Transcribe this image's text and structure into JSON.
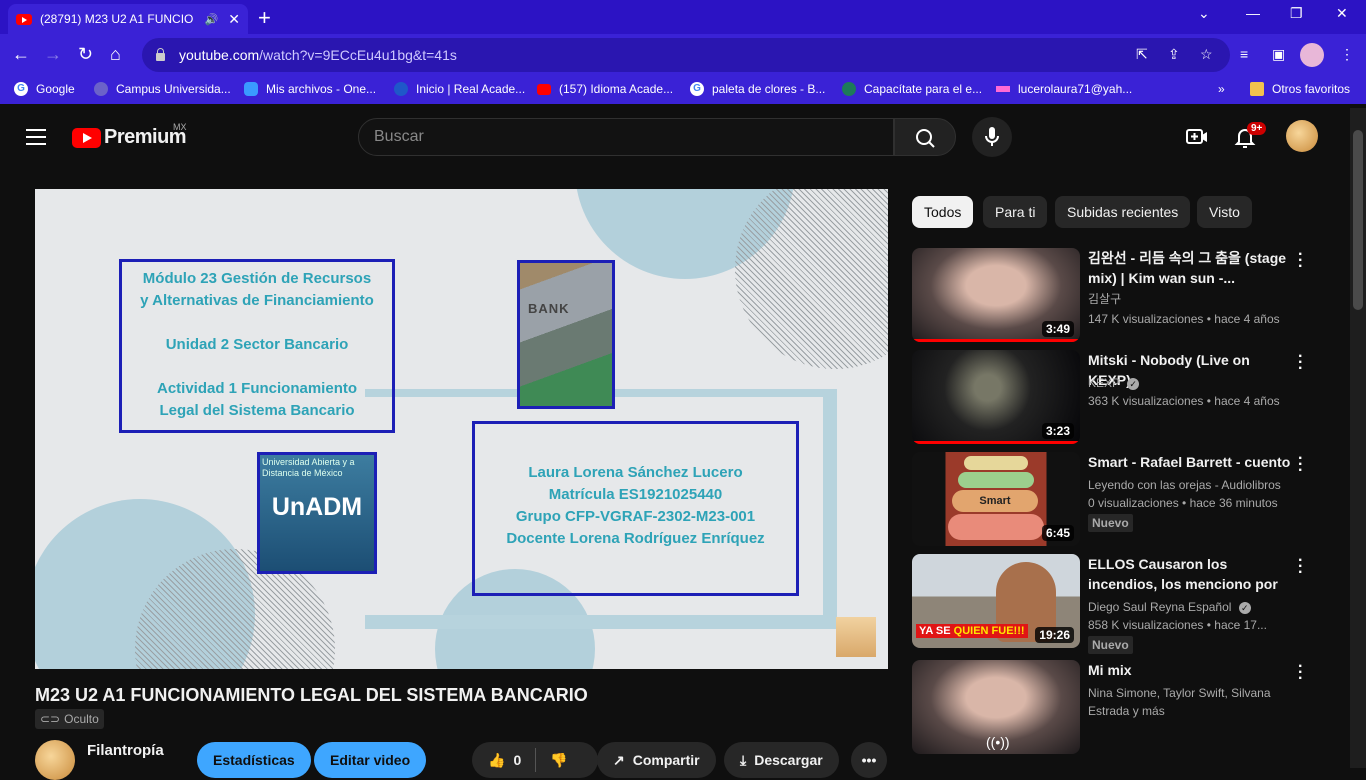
{
  "browser": {
    "tab_title": "(28791) M23 U2 A1 FUNCIO",
    "url_host": "youtube.com",
    "url_path": "/watch?v=9ECcEu4u1bg&t=41s",
    "bookmarks": [
      {
        "label": "Google",
        "icon": "google-icon"
      },
      {
        "label": "Campus Universida...",
        "icon": "campus-icon"
      },
      {
        "label": "Mis archivos - One...",
        "icon": "onedrive-icon"
      },
      {
        "label": "Inicio | Real Acade...",
        "icon": "rae-icon"
      },
      {
        "label": "(157) Idioma Acade...",
        "icon": "youtube-icon"
      },
      {
        "label": "paleta de clores - B...",
        "icon": "google-icon"
      },
      {
        "label": "Capacítate para el e...",
        "icon": "capacitate-icon"
      },
      {
        "label": "lucerolaura71@yah...",
        "icon": "yahoo-icon"
      }
    ],
    "other_bookmarks": "Otros favoritos"
  },
  "masthead": {
    "logo_text": "Premium",
    "region": "MX",
    "search_placeholder": "Buscar",
    "notification_count": "9+"
  },
  "slide": {
    "box1_lines": [
      "Módulo 23 Gestión de Recursos",
      "y Alternativas de Financiamiento",
      "",
      "Unidad 2 Sector Bancario",
      "",
      "Actividad 1 Funcionamiento",
      "Legal del Sistema Bancario"
    ],
    "box2_lines": [
      "Laura Lorena Sánchez Lucero",
      "Matrícula ES1921025440",
      "Grupo CFP-VGRAF-2302-M23-001",
      "Docente Lorena Rodríguez Enríquez"
    ],
    "logo_small": "Universidad Abierta y a Distancia de México",
    "logo_big": "UnADM",
    "bank_label": "BANK"
  },
  "video": {
    "title": "M23 U2 A1 FUNCIONAMIENTO LEGAL DEL SISTEMA BANCARIO",
    "privacy": "Oculto",
    "channel": "Filantropía",
    "stats_button": "Estadísticas",
    "edit_button": "Editar video",
    "likes": "0",
    "share": "Compartir",
    "download": "Descargar"
  },
  "chips": [
    "Todos",
    "Para ti",
    "Subidas recientes",
    "Visto"
  ],
  "recommendations": [
    {
      "title": "김완선 - 리듬 속의 그 춤을 (stage mix) | Kim wan sun -...",
      "channel": "김살구",
      "verified": false,
      "stats": "147 K visualizaciones • hace 4 años",
      "duration": "3:49",
      "badge": "",
      "watched": true
    },
    {
      "title": "Mitski - Nobody (Live on KEXP)",
      "channel": "KEXP",
      "verified": true,
      "stats": "363 K visualizaciones • hace 4 años",
      "duration": "3:23",
      "badge": "",
      "watched": true
    },
    {
      "title": "Smart - Rafael Barrett - cuento",
      "channel": "Leyendo con las orejas - Audiolibros",
      "verified": false,
      "stats": "0 visualizaciones • hace 36 minutos",
      "duration": "6:45",
      "badge": "Nuevo",
      "watched": false
    },
    {
      "title": "ELLOS Causaron los incendios, los menciono por Nombre! MY...",
      "channel": "Diego Saul Reyna Español",
      "verified": true,
      "stats": "858 K visualizaciones • hace 17...",
      "duration": "19:26",
      "badge": "Nuevo",
      "watched": false
    },
    {
      "title": "Mi mix",
      "channel": "Nina Simone, Taylor Swift, Silvana Estrada y más",
      "verified": false,
      "stats": "",
      "duration": "",
      "badge": "",
      "watched": false
    }
  ],
  "thumb_texts": {
    "smart": "Smart",
    "ya_se": "YA SE",
    "quien_fue": "QUIEN FUE!!!"
  }
}
